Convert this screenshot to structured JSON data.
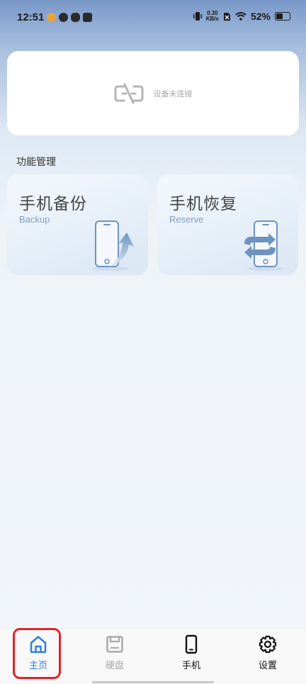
{
  "status_bar": {
    "time": "12:51",
    "net_speed_value": "0.30",
    "net_speed_unit": "KB/s",
    "battery": "52%"
  },
  "device_card": {
    "status_text": "设备未连接",
    "icon": "unlink-icon"
  },
  "section": {
    "title": "功能管理"
  },
  "functions": [
    {
      "title": "手机备份",
      "subtitle": "Backup",
      "icon": "phone-upload-icon"
    },
    {
      "title": "手机恢复",
      "subtitle": "Reserve",
      "icon": "phone-sync-icon"
    }
  ],
  "bottom_nav": [
    {
      "label": "主页",
      "icon": "home-icon",
      "state": "active",
      "color": "#2f7fd7"
    },
    {
      "label": "硬盘",
      "icon": "disk-icon",
      "state": "disabled",
      "color": "#a9a9a9"
    },
    {
      "label": "手机",
      "icon": "phone-icon",
      "state": "normal",
      "color": "#111111"
    },
    {
      "label": "设置",
      "icon": "gear-icon",
      "state": "normal",
      "color": "#111111"
    }
  ],
  "highlight": {
    "color": "#e0242c",
    "target": "主页"
  }
}
